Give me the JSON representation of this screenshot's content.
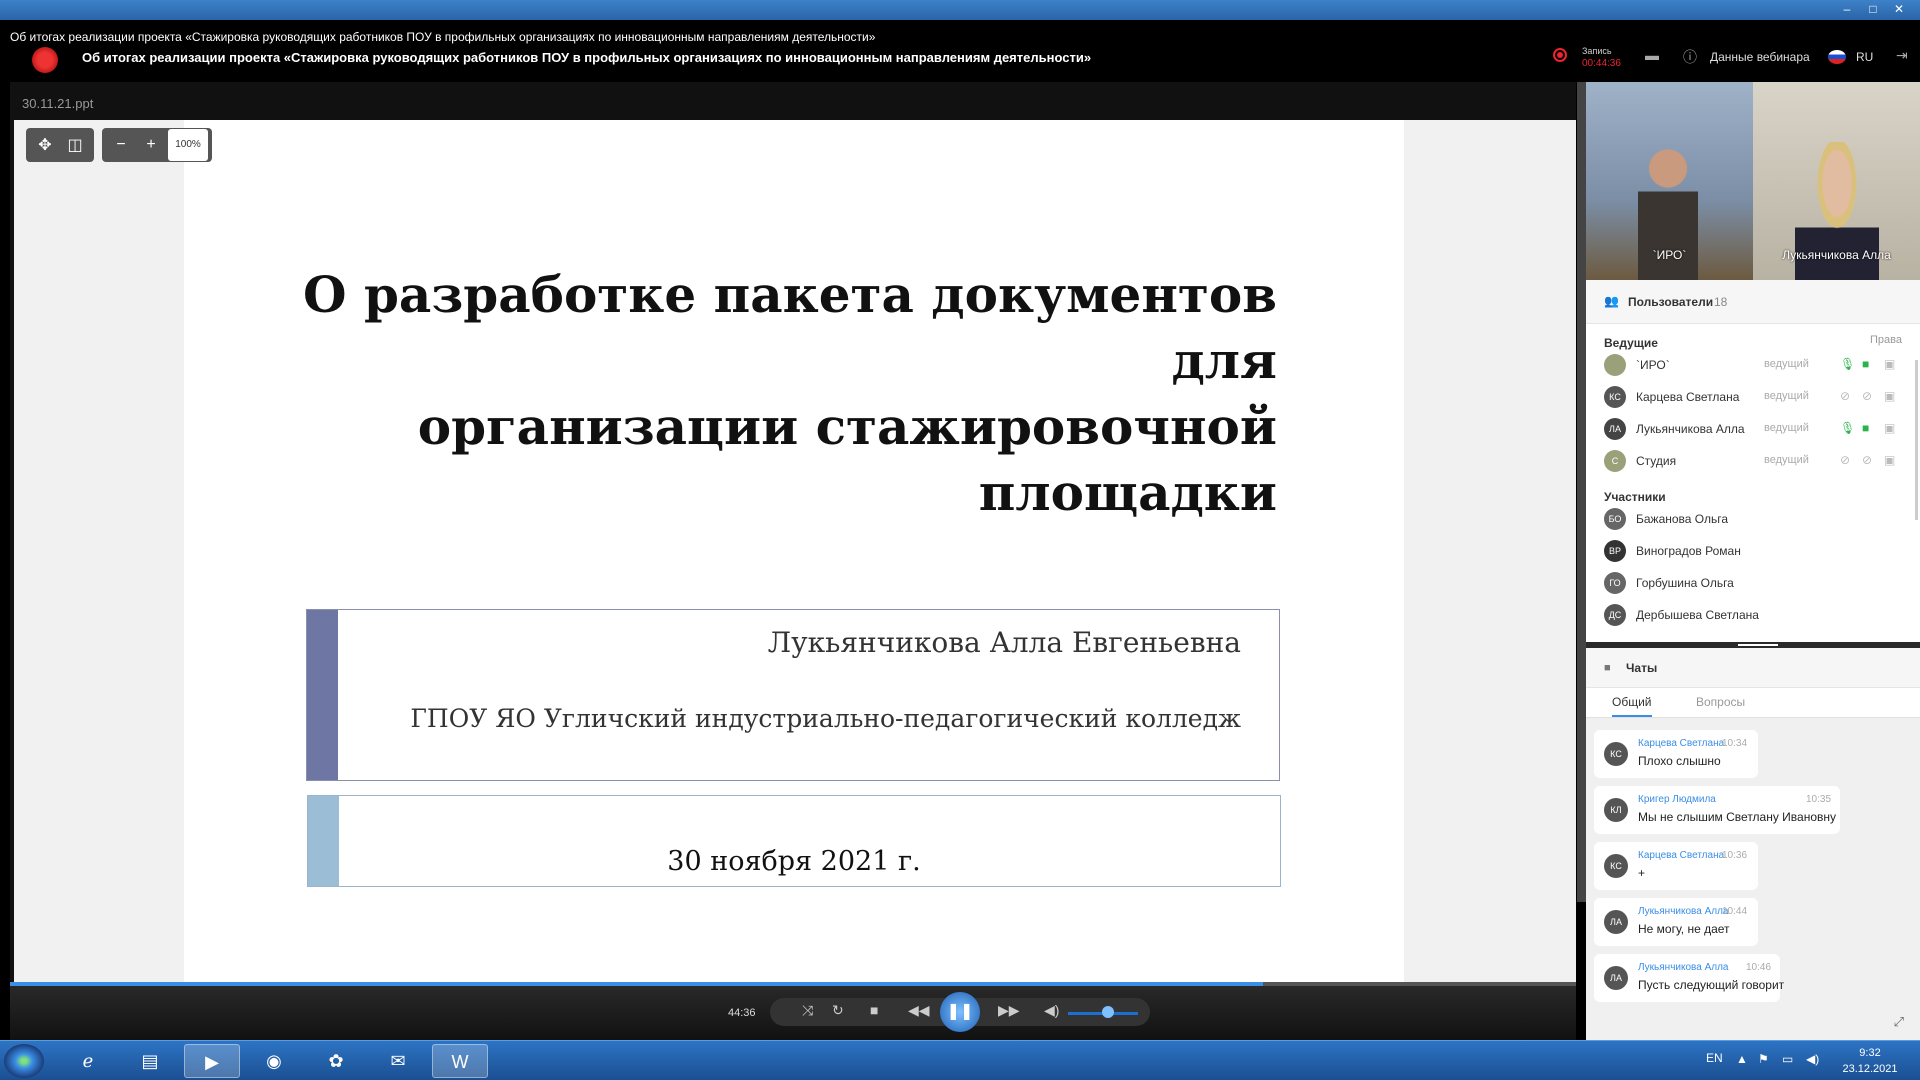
{
  "window": {
    "title": "Об итогах реализации проекта «Стажировка руководящих работников ПОУ в профильных организациях по инновационным направлениям деятельности»",
    "minimize": "–",
    "maximize": "□",
    "close": "✕"
  },
  "header": {
    "title": "Об итогах реализации проекта «Стажировка руководящих работников ПОУ в профильных организациях по инновационным направлениям деятельности»",
    "record_label": "Запись",
    "record_time": "00:44:36",
    "webinar_info": "Данные вебинара",
    "language": "RU"
  },
  "presentation": {
    "file_name": "30.11.21.ppt",
    "zoom": "100%",
    "slide": {
      "title_line1": "О разработке пакета документов для",
      "title_line2": "организации стажировочной",
      "title_line3": "площадки",
      "author": "Лукьянчикова Алла Евгеньевна",
      "organization": "ГПОУ ЯО Угличский индустриально-педагогический колледж",
      "date": "30 ноября 2021 г."
    }
  },
  "player": {
    "time": "44:36",
    "progress_fraction": 0.8
  },
  "videos": [
    {
      "label": "`ИРО`"
    },
    {
      "label": "Лукьянчикова Алла"
    }
  ],
  "users": {
    "title": "Пользователи",
    "count": "18",
    "hosts_label": "Ведущие",
    "rights_label": "Права",
    "hosts": [
      {
        "initials": "",
        "name": "`ИРО`",
        "role": "ведущий",
        "color": "#9aa07a"
      },
      {
        "initials": "КС",
        "name": "Карцева Светлана",
        "role": "ведущий",
        "color": "#555555"
      },
      {
        "initials": "ЛА",
        "name": "Лукьянчикова Алла",
        "role": "ведущий",
        "color": "#444444"
      },
      {
        "initials": "С",
        "name": "Студия",
        "role": "ведущий",
        "color": "#9aa07a"
      }
    ],
    "participants_label": "Участники",
    "participants": [
      {
        "initials": "БО",
        "name": "Бажанова Ольга",
        "color": "#666666"
      },
      {
        "initials": "ВР",
        "name": "Виноградов Роман",
        "color": "#333333"
      },
      {
        "initials": "ГО",
        "name": "Горбушина Ольга",
        "color": "#666666"
      },
      {
        "initials": "ДС",
        "name": "Дербышева Светлана",
        "color": "#555555"
      }
    ]
  },
  "chats": {
    "title": "Чаты",
    "tab_general": "Общий",
    "tab_questions": "Вопросы",
    "messages": [
      {
        "initials": "КС",
        "author": "Карцева Светлана",
        "time": "10:34",
        "text": "Плохо слышно"
      },
      {
        "initials": "КЛ",
        "author": "Кригер Людмила",
        "time": "10:35",
        "text": "Мы не слышим Светлану Ивановну"
      },
      {
        "initials": "КС",
        "author": "Карцева Светлана",
        "time": "10:36",
        "text": "+"
      },
      {
        "initials": "ЛА",
        "author": "Лукьянчикова Алла",
        "time": "10:44",
        "text": "Не могу, не дает"
      },
      {
        "initials": "ЛА",
        "author": "Лукьянчикова Алла",
        "time": "10:46",
        "text": "Пусть следующий говорит"
      }
    ]
  },
  "taskbar": {
    "language": "EN",
    "time": "9:32",
    "date": "23.12.2021"
  }
}
